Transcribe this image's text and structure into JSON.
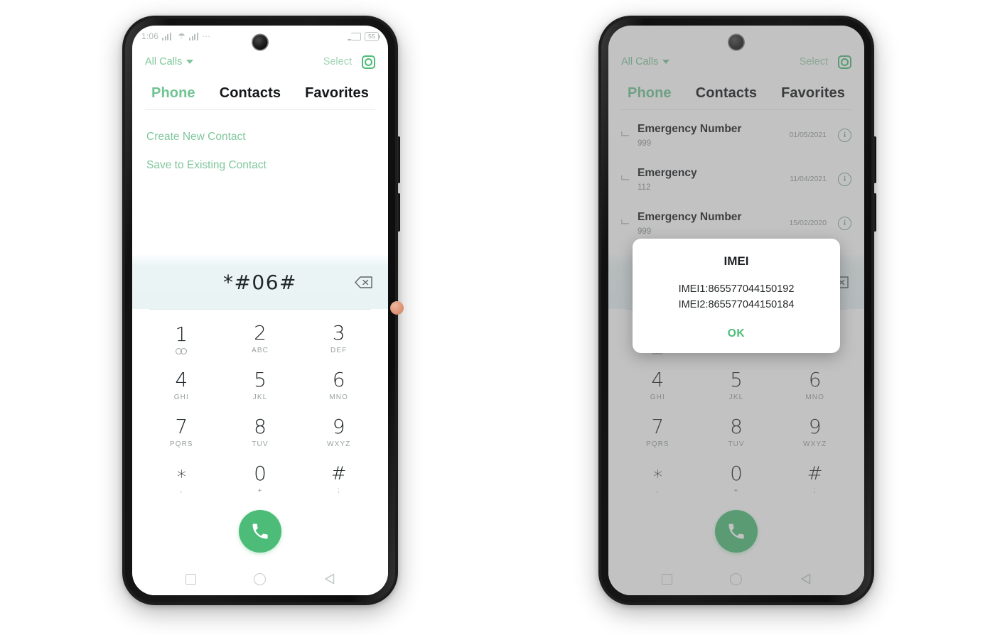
{
  "status_bar": {
    "time": "1:06",
    "signal_icon": "signal-bars-icon",
    "wifi_icon": "wifi-icon",
    "dual_sim_icon": "dual-sim-signal-icon",
    "overflow_icon": "more-dots-icon",
    "cast_icon": "screen-cast-icon",
    "battery_level": "55"
  },
  "app_bar": {
    "filter_label": "All Calls",
    "filter_caret_icon": "chevron-down-icon",
    "select_label": "Select",
    "settings_icon": "gear-icon"
  },
  "tabs": [
    {
      "label": "Phone",
      "active": true
    },
    {
      "label": "Contacts",
      "active": false
    },
    {
      "label": "Favorites",
      "active": false
    }
  ],
  "suggestions": [
    {
      "label": "Create New Contact"
    },
    {
      "label": "Save to Existing Contact"
    }
  ],
  "call_log": [
    {
      "name": "Emergency Number",
      "number": "999",
      "date": "01/05/2021",
      "info_icon": "info-circle-icon",
      "direction_icon": "outgoing-call-icon"
    },
    {
      "name": "Emergency",
      "number": "112",
      "date": "11/04/2021",
      "info_icon": "info-circle-icon",
      "direction_icon": "outgoing-call-icon"
    },
    {
      "name": "Emergency Number",
      "number": "999",
      "date": "15/02/2020",
      "info_icon": "info-circle-icon",
      "direction_icon": "outgoing-call-icon"
    }
  ],
  "dialer": {
    "entered_number": "*#06#",
    "backspace_icon": "backspace-icon",
    "call_icon": "phone-handset-icon",
    "keys": [
      {
        "digit": "1",
        "sub": "",
        "glyph": "voicemail-icon"
      },
      {
        "digit": "2",
        "sub": "ABC",
        "glyph": ""
      },
      {
        "digit": "3",
        "sub": "DEF",
        "glyph": ""
      },
      {
        "digit": "4",
        "sub": "GHI",
        "glyph": ""
      },
      {
        "digit": "5",
        "sub": "JKL",
        "glyph": ""
      },
      {
        "digit": "6",
        "sub": "MNO",
        "glyph": ""
      },
      {
        "digit": "7",
        "sub": "PQRS",
        "glyph": ""
      },
      {
        "digit": "8",
        "sub": "TUV",
        "glyph": ""
      },
      {
        "digit": "9",
        "sub": "WXYZ",
        "glyph": ""
      },
      {
        "digit": "∗",
        "sub": ",",
        "glyph": ""
      },
      {
        "digit": "0",
        "sub": "+",
        "glyph": ""
      },
      {
        "digit": "#",
        "sub": ";",
        "glyph": ""
      }
    ],
    "pressed_key": "6"
  },
  "nav_bar": {
    "recents_icon": "square-recents-icon",
    "home_icon": "circle-home-icon",
    "back_icon": "triangle-back-icon"
  },
  "imei_dialog": {
    "title": "IMEI",
    "line1": "IMEI1:865577044150192",
    "line2": "IMEI2:865577044150184",
    "ok_label": "OK"
  },
  "colors": {
    "accent_green": "#4cbc78",
    "tab_active_green": "#6fc493",
    "link_green": "#7fc79c",
    "dial_input_bg": "#eaf4f5",
    "scrim": "#a9a9a9",
    "frame": "#1d1d1d"
  }
}
